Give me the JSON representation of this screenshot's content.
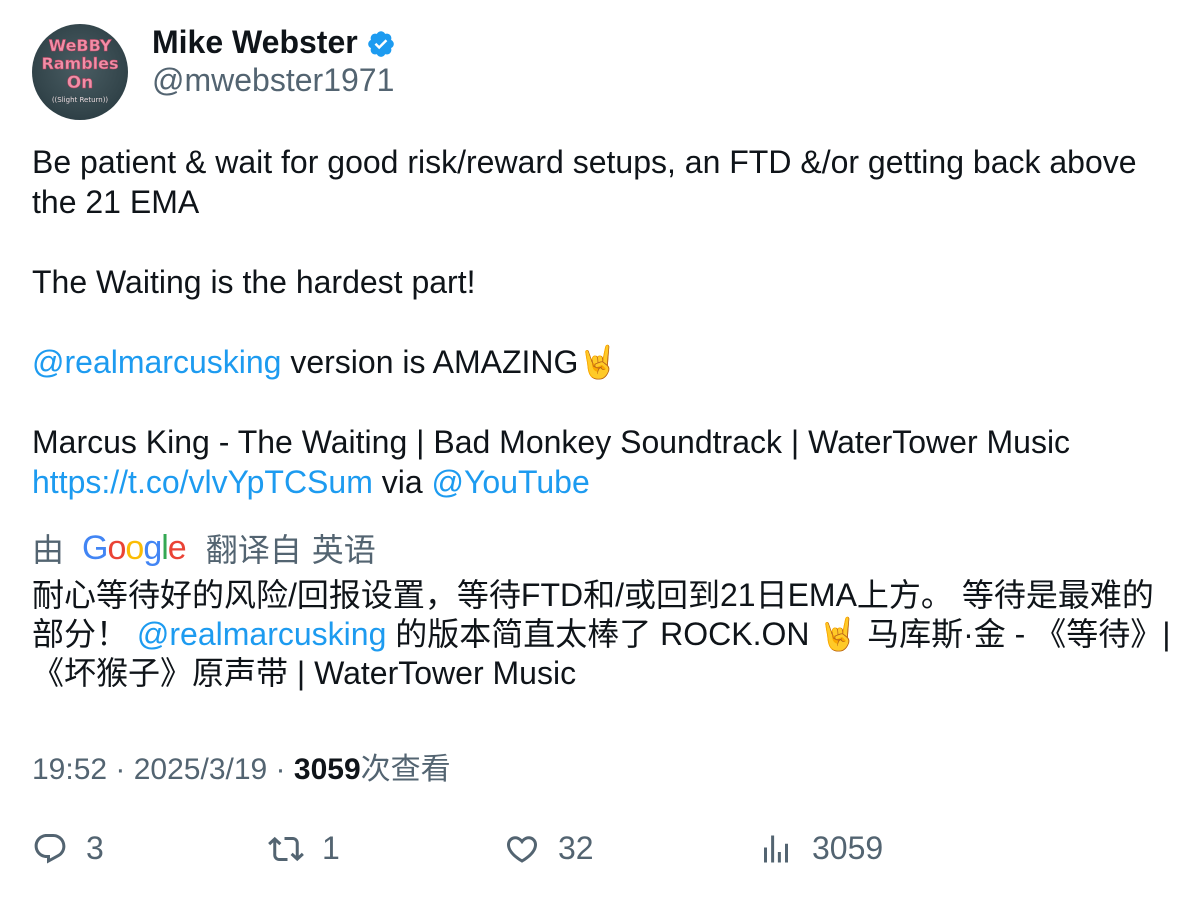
{
  "author": {
    "display_name": "Mike Webster",
    "handle": "@mwebster1971",
    "avatar_text": [
      "WeBBY",
      "Rambles",
      "On",
      "((Slight Return))"
    ],
    "verified_color": "#1d9bf0"
  },
  "tweet": {
    "line1": "Be patient & wait for good risk/reward setups, an FTD &/or getting back above the 21 EMA",
    "line2": "The Waiting is the hardest part!",
    "mention1": "@realmarcusking",
    "line3_rest": " version is AMAZING",
    "emoji1": "🤘",
    "line4": "Marcus King - The Waiting | Bad Monkey Soundtrack | WaterTower Music",
    "url": "https://t.co/vlvYpTCSum",
    "via": " via ",
    "mention2": "@YouTube"
  },
  "translation": {
    "prefix": "由",
    "google": "Google",
    "translated_from": "翻译自",
    "language": "英语",
    "text_part1": "耐心等待好的风险/回报设置，等待FTD和/或回到21日EMA上方。 等待是最难的部分！ ",
    "mention": "@realmarcusking",
    "text_part2": " 的版本简直太棒了 ROCK.ON ",
    "emoji": "🤘",
    "text_part3": " 马库斯·金 - 《等待》| 《坏猴子》原声带 | WaterTower Music"
  },
  "meta": {
    "time": "19:52",
    "sep": " · ",
    "date": "2025/3/19",
    "views_count": "3059",
    "views_label": "次查看"
  },
  "actions": {
    "replies": "3",
    "reposts": "1",
    "likes": "32",
    "views": "3059"
  },
  "colors": {
    "link": "#1d9bf0",
    "secondary": "#536471",
    "primary": "#0f1419"
  }
}
